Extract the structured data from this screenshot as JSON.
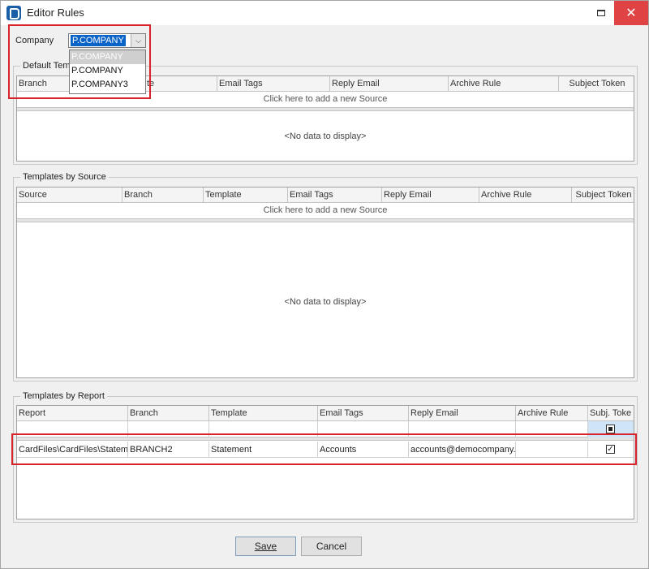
{
  "window": {
    "title": "Editor Rules"
  },
  "company": {
    "label": "Company",
    "selected": "P.COMPANY",
    "options": [
      "P.COMPANY",
      "P.COMPANY",
      "P.COMPANY3"
    ]
  },
  "default_templates": {
    "title": "Default Tem",
    "columns": [
      "Branch",
      "te",
      "Email Tags",
      "Reply Email",
      "Archive Rule",
      "Subject Token"
    ],
    "add_row": "Click here to add a new Source",
    "empty": "<No data to display>"
  },
  "templates_by_source": {
    "title": "Templates by Source",
    "columns": [
      "Source",
      "Branch",
      "Template",
      "Email Tags",
      "Reply Email",
      "Archive Rule",
      "Subject Token"
    ],
    "add_row": "Click here to add a new Source",
    "empty": "<No data to display>"
  },
  "templates_by_report": {
    "title": "Templates by Report",
    "columns": [
      "Report",
      "Branch",
      "Template",
      "Email Tags",
      "Reply Email",
      "Archive Rule",
      "Subj. Toke"
    ],
    "rows": [
      {
        "report": "CardFiles\\CardFiles\\Stateme",
        "branch": "BRANCH2",
        "template": "Statement",
        "email_tags": "Accounts",
        "reply_email": "accounts@democompany.c",
        "archive_rule": "",
        "subject_token": "✓"
      }
    ]
  },
  "buttons": {
    "save": "Save",
    "cancel": "Cancel"
  },
  "colors": {
    "highlight": "#d9222a",
    "selection": "#0a64c8",
    "close": "#e04343"
  }
}
